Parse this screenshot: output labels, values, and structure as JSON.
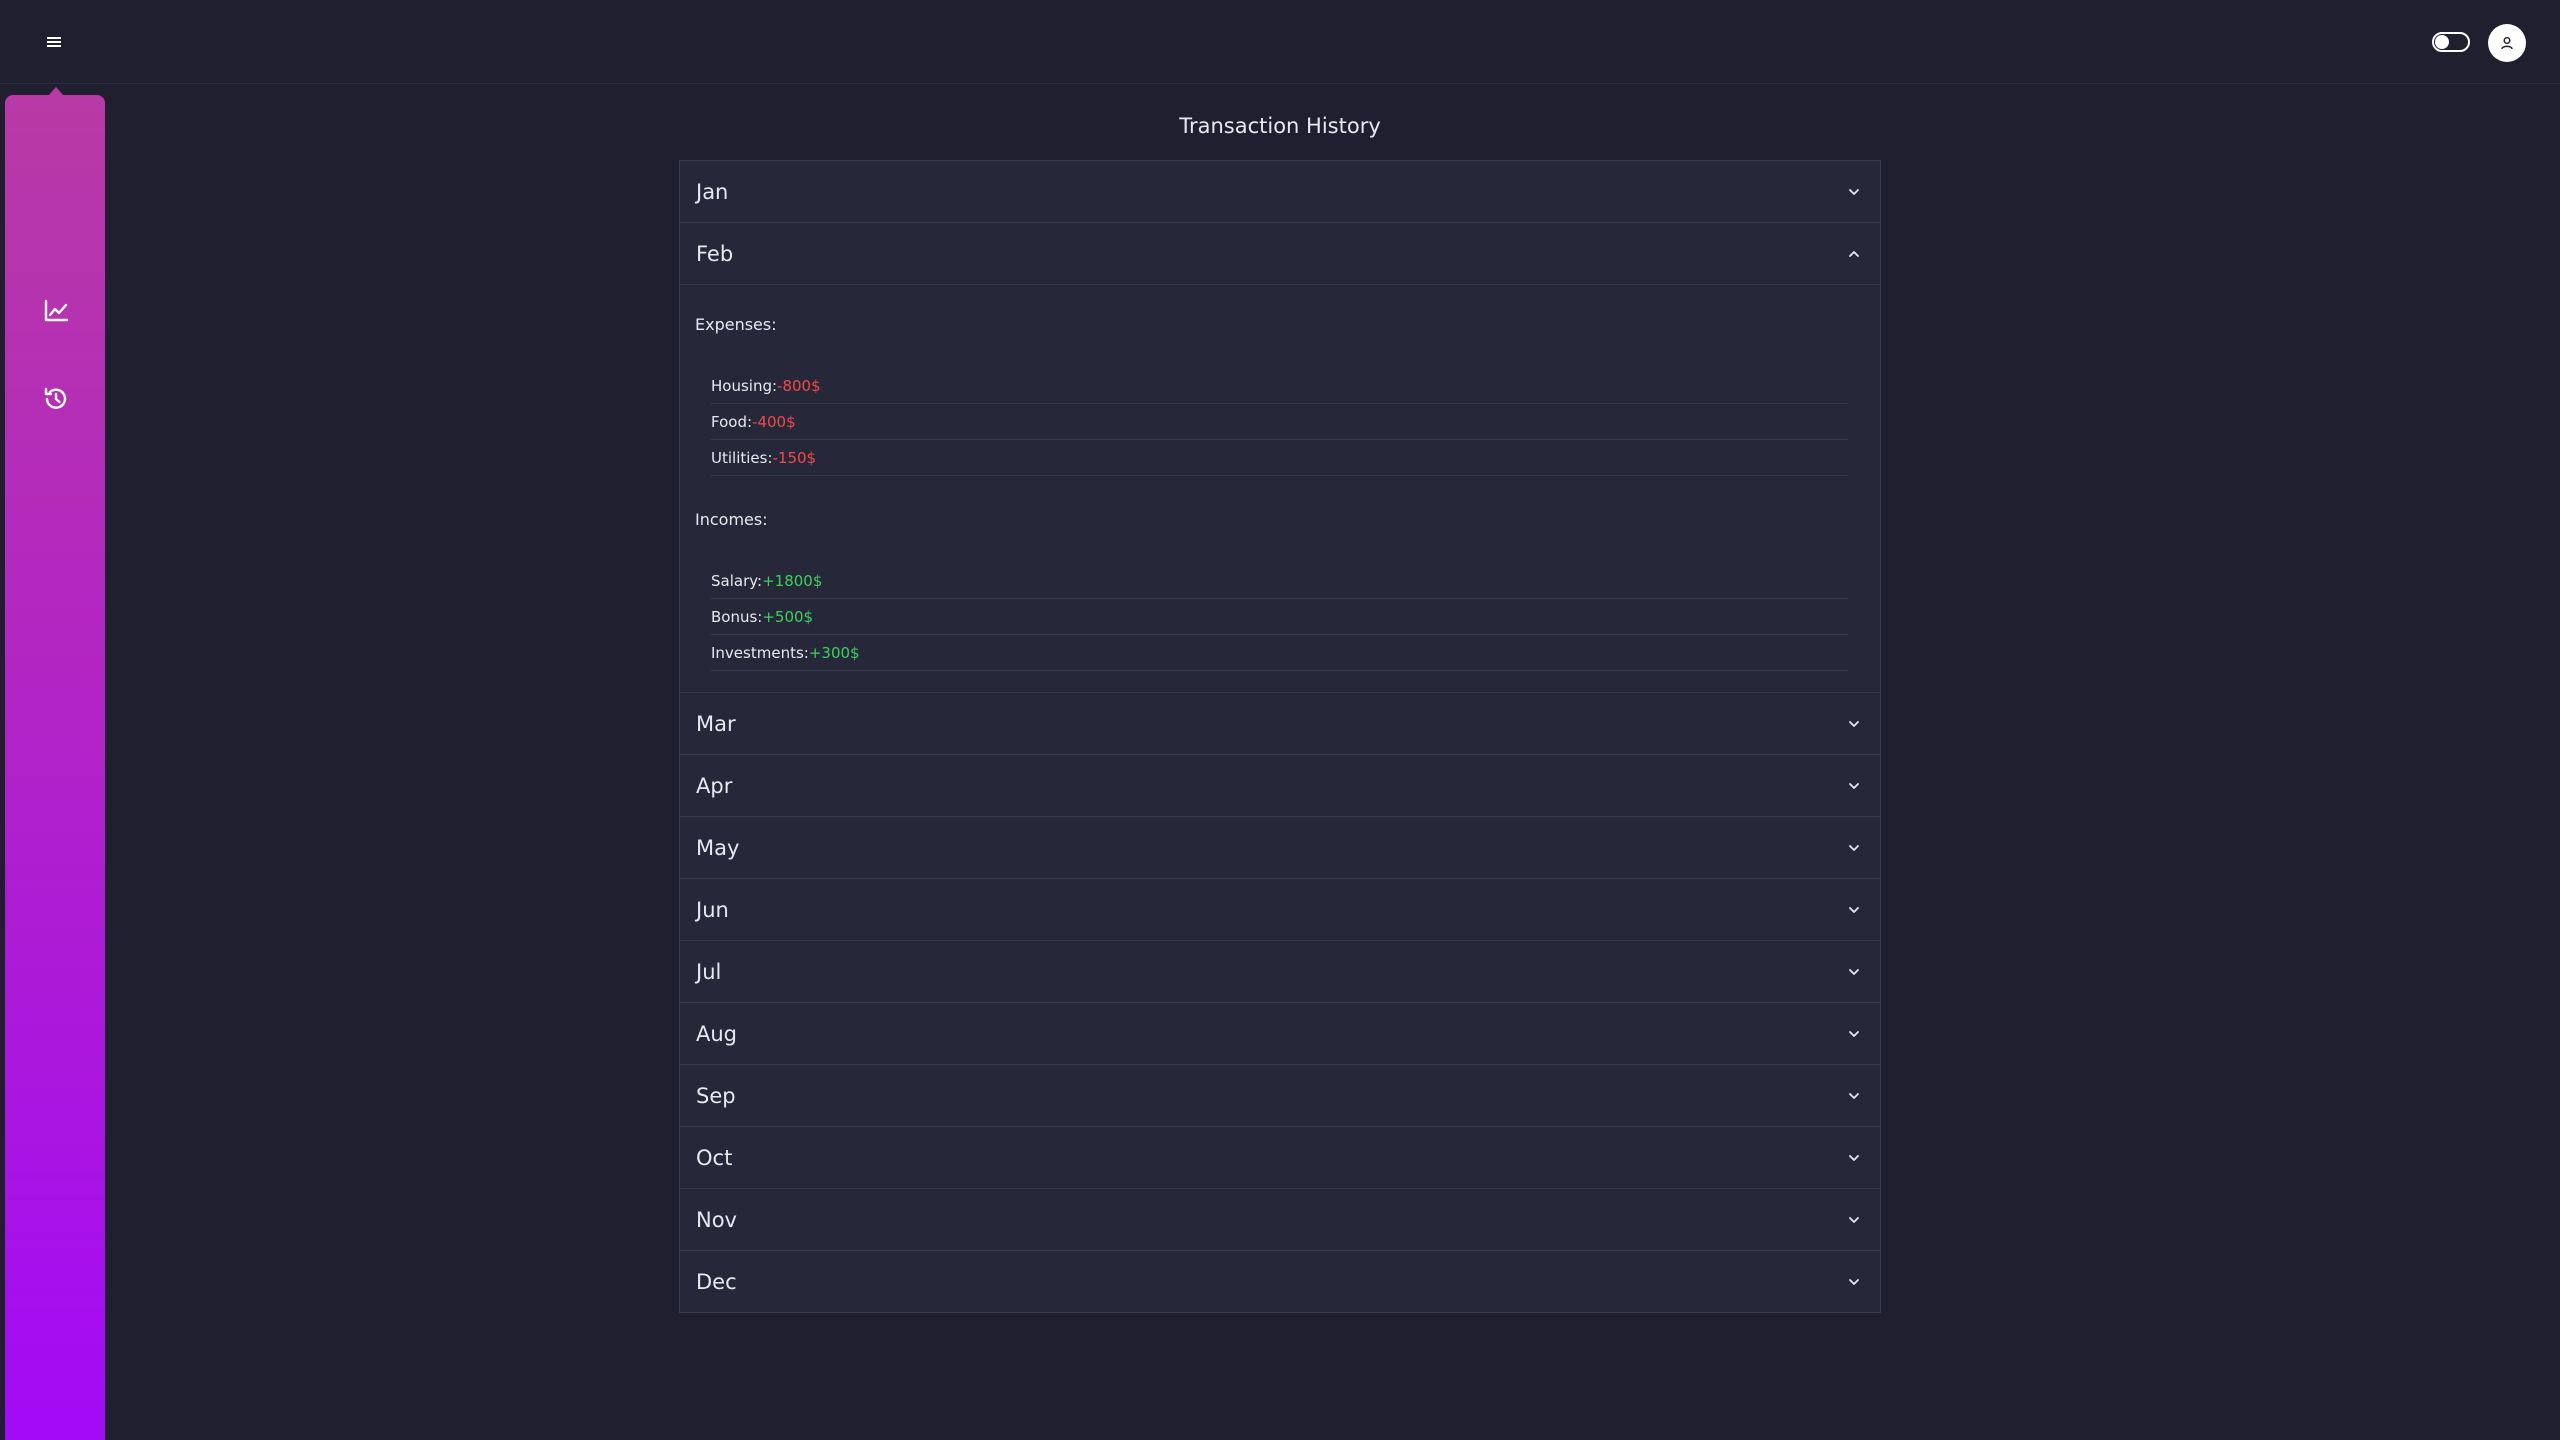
{
  "header": {
    "menu_icon": "hamburger-icon",
    "theme_toggle_icon": "toggle-icon",
    "avatar_icon": "user-icon"
  },
  "sidebar": {
    "items": [
      {
        "icon": "chart-line-icon"
      },
      {
        "icon": "history-icon"
      }
    ],
    "gradient": [
      "#b83aa5",
      "#a30af7"
    ]
  },
  "page": {
    "title": "Transaction History"
  },
  "months": [
    {
      "label": "Jan",
      "expanded": false
    },
    {
      "label": "Feb",
      "expanded": true
    },
    {
      "label": "Mar",
      "expanded": false
    },
    {
      "label": "Apr",
      "expanded": false
    },
    {
      "label": "May",
      "expanded": false
    },
    {
      "label": "Jun",
      "expanded": false
    },
    {
      "label": "Jul",
      "expanded": false
    },
    {
      "label": "Aug",
      "expanded": false
    },
    {
      "label": "Sep",
      "expanded": false
    },
    {
      "label": "Oct",
      "expanded": false
    },
    {
      "label": "Nov",
      "expanded": false
    },
    {
      "label": "Dec",
      "expanded": false
    }
  ],
  "feb_details": {
    "expenses_title": "Expenses:",
    "expenses": [
      {
        "key": "Housing:",
        "value": "-800$"
      },
      {
        "key": "Food:",
        "value": "-400$"
      },
      {
        "key": "Utilities:",
        "value": "-150$"
      }
    ],
    "incomes_title": "Incomes:",
    "incomes": [
      {
        "key": "Salary:",
        "value": "+1800$"
      },
      {
        "key": "Bonus:",
        "value": "+500$"
      },
      {
        "key": "Investments:",
        "value": "+300$"
      }
    ]
  },
  "colors": {
    "background": "#1f1f2f",
    "panel": "#262839",
    "expense": "#f04a4a",
    "income": "#3ecf5e"
  }
}
